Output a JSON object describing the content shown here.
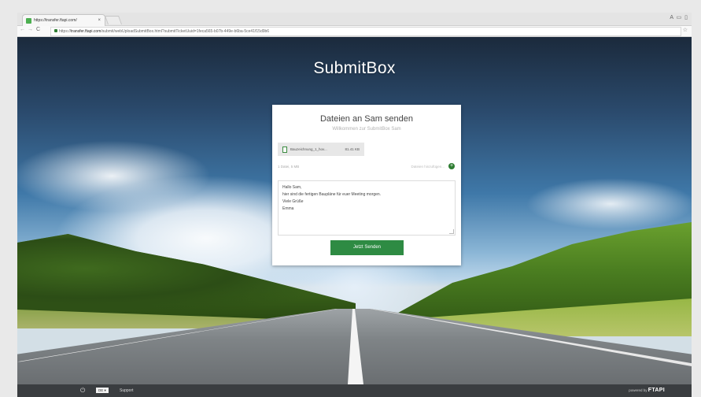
{
  "browser": {
    "tab_title": "https://transfer.ftapi.com/",
    "tab_close": "×",
    "window_controls": "A ▭ ▯",
    "url_prefix": "https://",
    "url_host": "transfer.ftapi.com",
    "url_path": "/submit/webUploadSubmitBox.html?submitTicketUuid=1feca565-b07b-449e-b6ba-5ce41f15d9b6",
    "back": "←",
    "forward": "→",
    "reload": "C",
    "star": "☆"
  },
  "page": {
    "brand_title": "SubmitBox",
    "card": {
      "title": "Dateien an Sam senden",
      "subtitle": "Willkommen zur SubmitBox Sam",
      "file": {
        "name": "Bauzeichnung_1_hov...",
        "size": "81.41 KB"
      },
      "file_count": "1 Datei, 5 MB",
      "add_files": "Dateien hinzufügen...",
      "add_icon_glyph": "+",
      "message_lines": [
        "Hallo Sam,",
        "hier sind die fertigen Baupläne für euer Meeting morgen.",
        "Viele Grüße",
        "Emma"
      ],
      "send_label": "Jetzt Senden"
    }
  },
  "footer": {
    "power_glyph": "⏻",
    "language": "DE ▾",
    "support": "Support",
    "powered_by": "powered by",
    "brand": "FTAPI"
  },
  "colors": {
    "accent_green": "#2e8b43",
    "footer_bg": "#3a3d40"
  }
}
